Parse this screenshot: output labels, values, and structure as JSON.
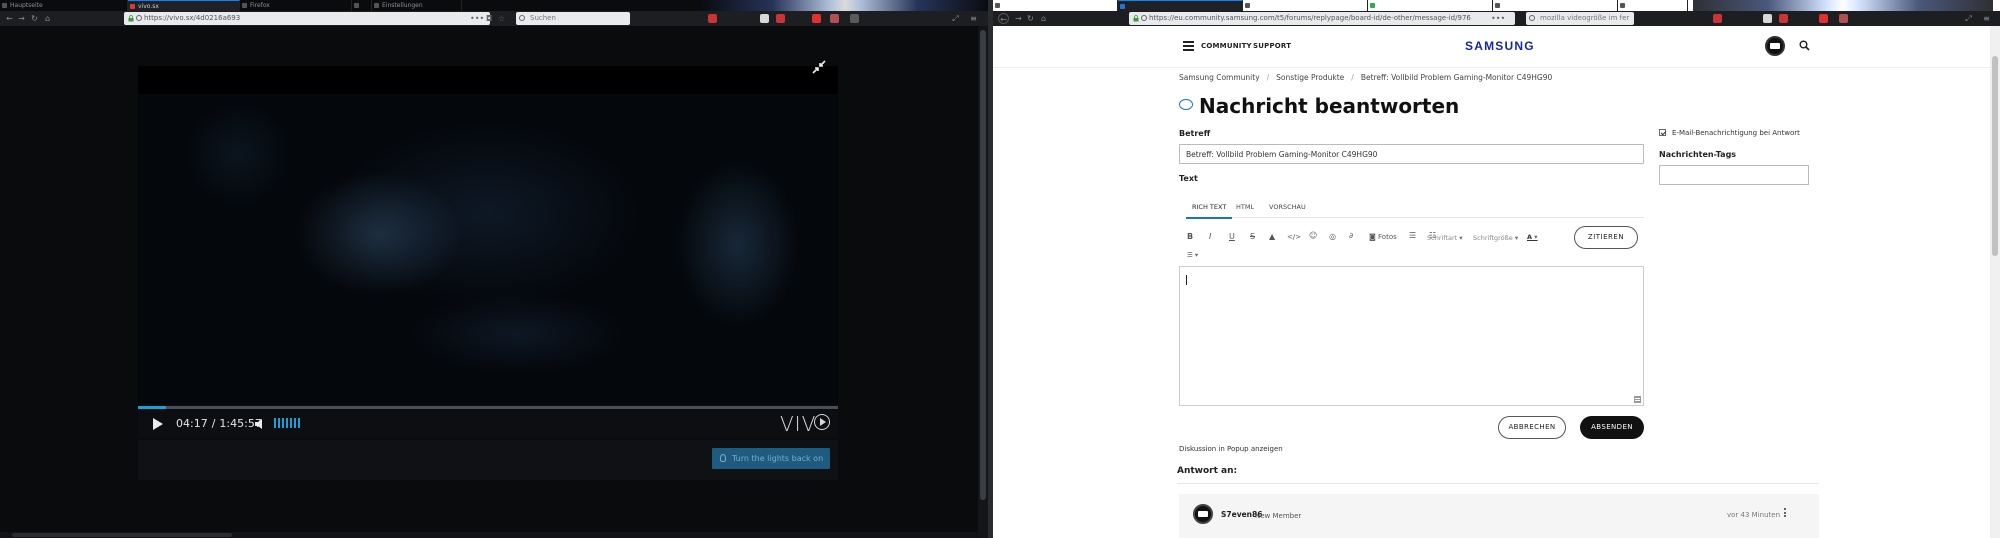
{
  "left_browser": {
    "tabs": [
      {
        "title": "Hauptseite",
        "state": "inactive"
      },
      {
        "title": "vivo.sx",
        "state": "active"
      },
      {
        "title": "Firefox",
        "state": "inactive"
      },
      {
        "title": "",
        "state": "inactive"
      },
      {
        "title": "Einstellungen",
        "state": "inactive"
      }
    ],
    "url": "https://vivo.sx/4d0216a693",
    "search_placeholder": "Suchen"
  },
  "video": {
    "current_time": "04:17",
    "separator": "/",
    "duration": "1:45:57",
    "progress_fraction": 0.04,
    "volume_bars": 7,
    "logo_text": "VIV",
    "lights_button_label": "Turn the lights back on",
    "accent_color": "#1ea0d6"
  },
  "right_browser": {
    "tabs": [
      {
        "title": "",
        "state": "inactive"
      },
      {
        "title": "",
        "state": "active"
      },
      {
        "title": "",
        "state": "inactive"
      },
      {
        "title": "",
        "state": "inactive"
      },
      {
        "title": "",
        "state": "inactive"
      },
      {
        "title": "",
        "state": "inactive"
      }
    ],
    "url": "https://eu.community.samsung.com/t5/forums/replypage/board-id/de-other/message-id/976",
    "search_value": "mozilla videogröße im fer"
  },
  "samsung": {
    "nav_community": "COMMUNITY",
    "nav_support": "SUPPORT",
    "logo": "SAMSUNG",
    "brand_color": "#1428a0",
    "breadcrumb": [
      "Samsung Community",
      "Sonstige Produkte",
      "Betreff: Vollbild Problem Gaming-Monitor C49HG90"
    ],
    "page_title": "Nachricht beantworten",
    "subject_label": "Betreff",
    "subject_value": "Betreff: Vollbild Problem Gaming-Monitor C49HG90",
    "text_label": "Text",
    "editor_tabs": [
      "RICH TEXT",
      "HTML",
      "VORSCHAU"
    ],
    "toolbar": {
      "bold": "B",
      "italic": "I",
      "underline": "U",
      "strike": "S",
      "photos": "Fotos",
      "font": "Schriftart",
      "font_size": "Schriftgröße",
      "quote": "ZITIEREN"
    },
    "cancel_label": "ABBRECHEN",
    "submit_label": "ABSENDEN",
    "popup_link": "Diskussion in Popup anzeigen",
    "reply_to_label": "Antwort an:",
    "reply_user": "S7even86",
    "reply_rank": "New Member",
    "reply_time": "vor 43 Minuten",
    "email_notify": "E-Mail-Benachrichtigung bei Antwort",
    "email_notify_checked": true,
    "tags_label": "Nachrichten-Tags"
  }
}
